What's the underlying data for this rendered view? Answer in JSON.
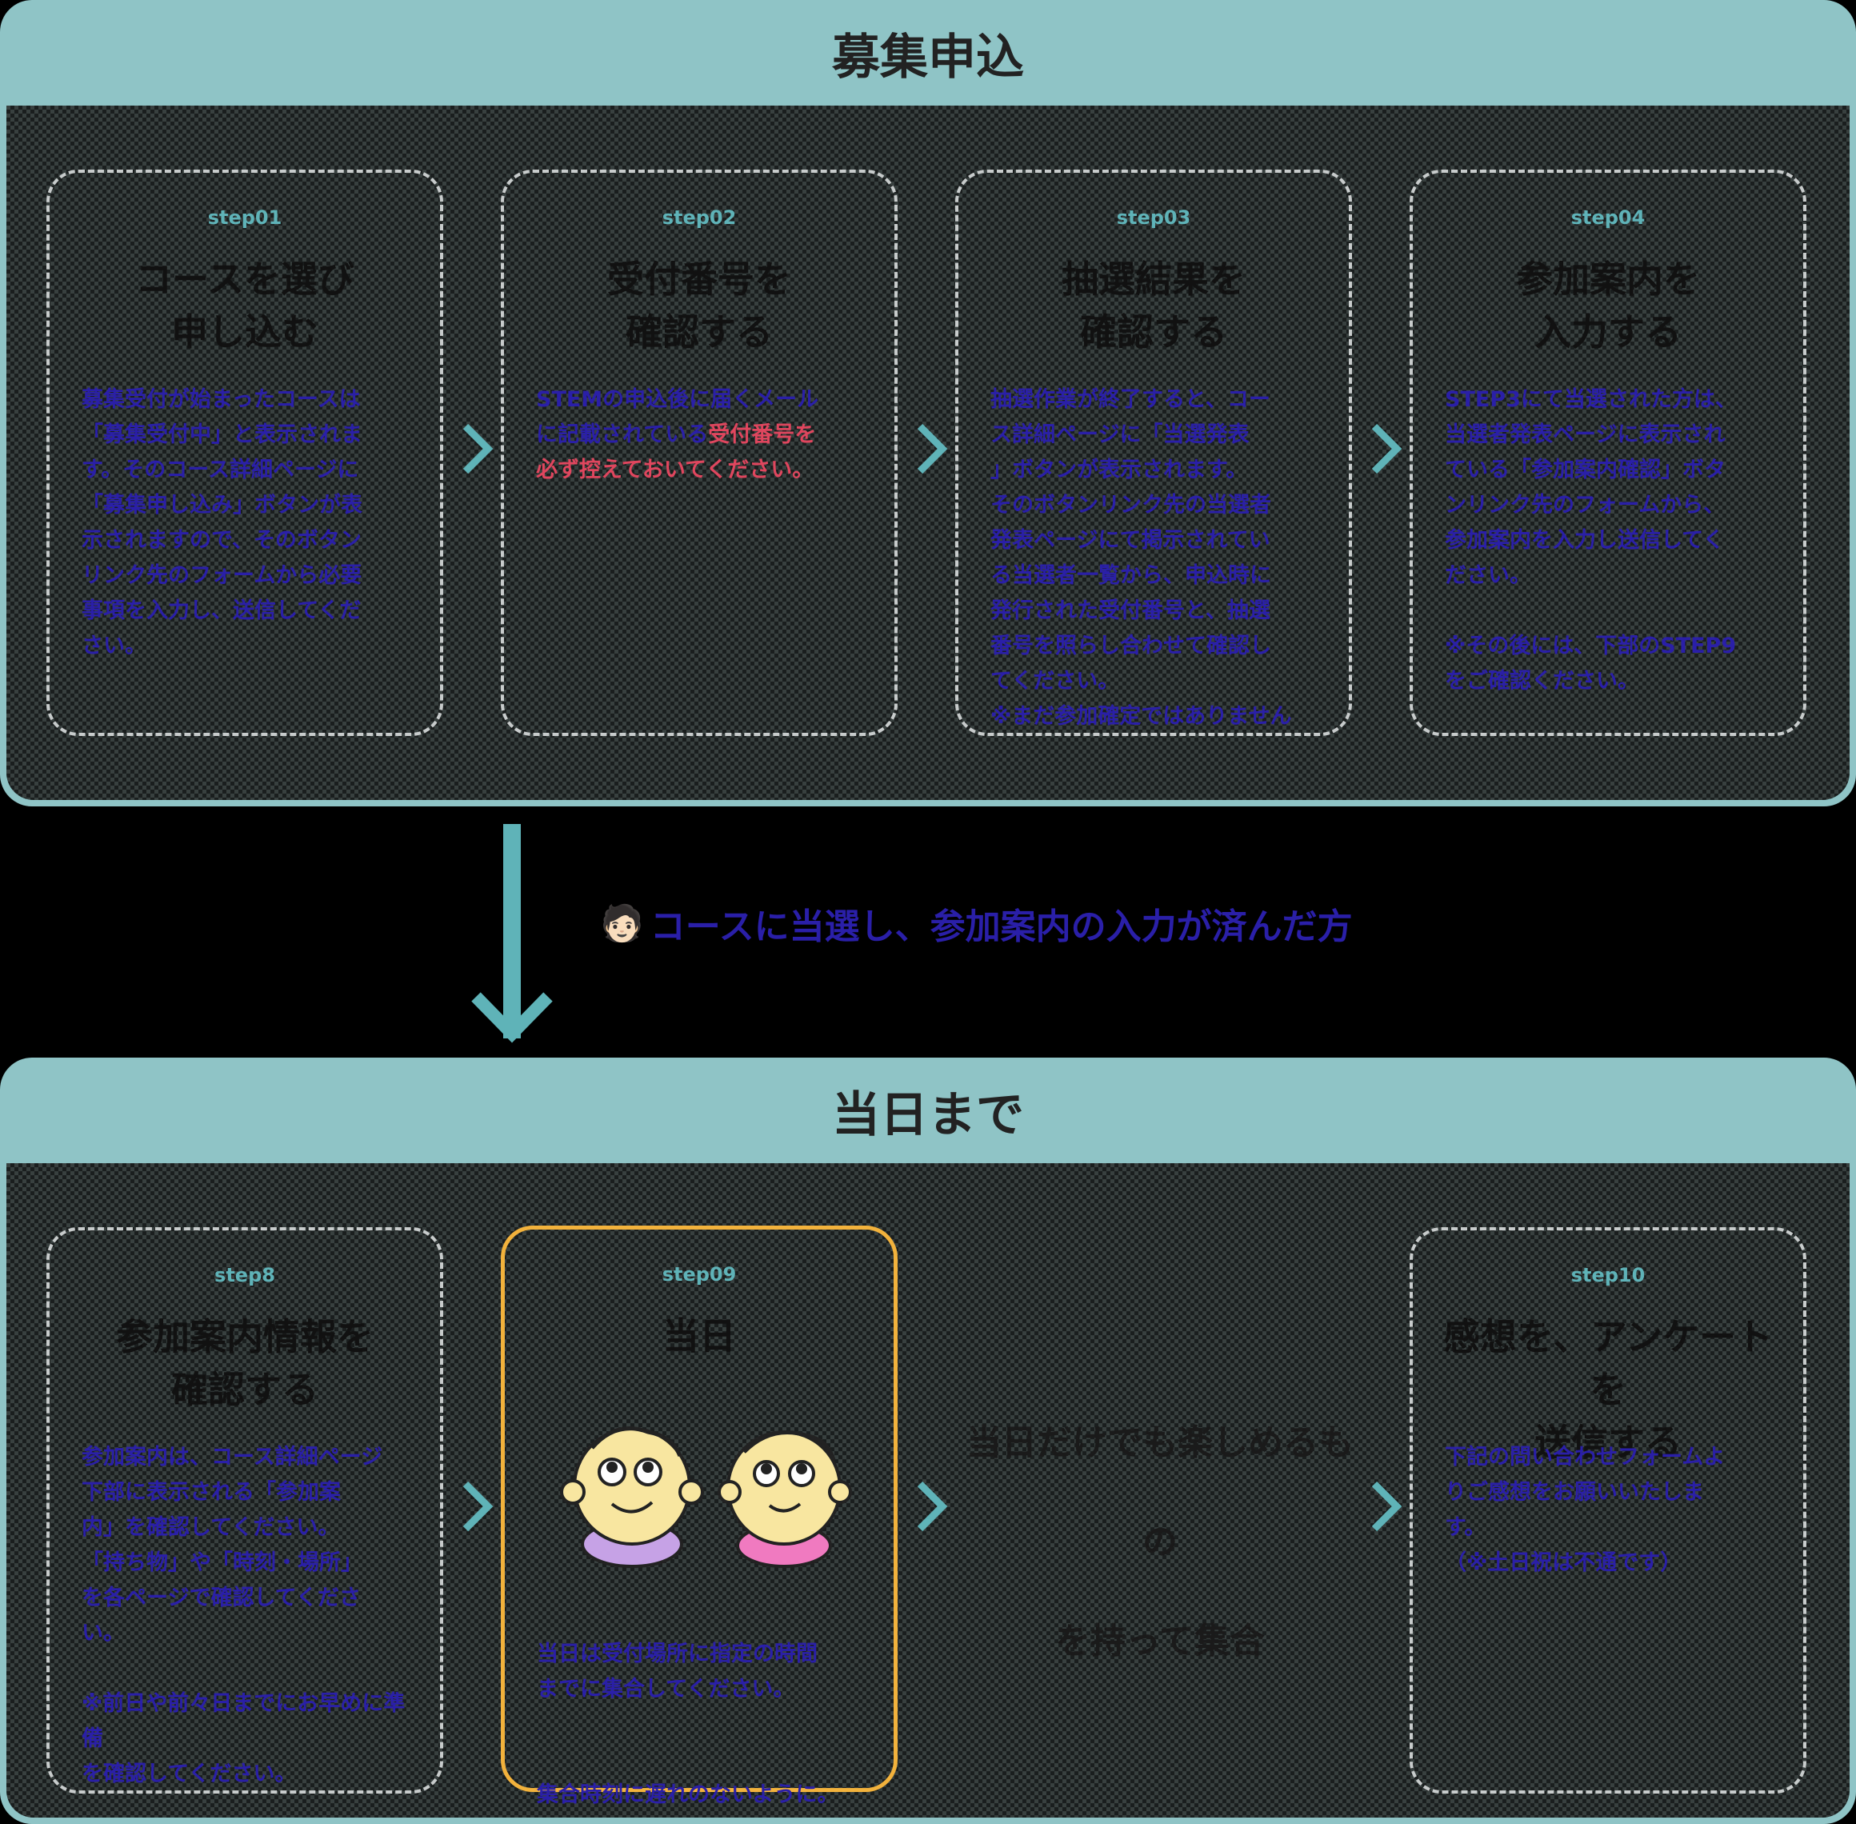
{
  "panel1": {
    "title": "募集申込",
    "cards": [
      {
        "step": "step01",
        "title_line1": "コースを選び",
        "title_line2": "申し込む",
        "text": "募集受付が始まったコースは\n「募集受付中」と表示されま\nす。そのコース詳細ページに\n「募集申し込み」ボタンが表\n示されますので、そのボタン\nリンク先のフォームから必要\n事項を入力し、送信してくだ\nさい。"
      },
      {
        "step": "step02",
        "title_line1": "受付番号を",
        "title_line2": "確認する",
        "text_a": "STEMの申込後に届くメール\nに記載されている",
        "text_red": "受付番号を\n必ず控えておいてください。"
      },
      {
        "step": "step03",
        "title_line1": "抽選結果を",
        "title_line2": "確認する",
        "text": "抽選作業が終了すると、コー\nス詳細ページに「当選発表\n」ボタンが表示されます。\nそのボタンリンク先の当選者\n発表ページにて掲示されてい\nる当選者一覧から、申込時に\n発行された受付番号と、抽選\n番号を照らし合わせて確認し\nてください。\n※まだ参加確定ではありません"
      },
      {
        "step": "step04",
        "title_line1": "参加案内を",
        "title_line2": "入力する",
        "text": "STEP3にて当選された方は、\n当選者発表ページに表示され\nている「参加案内確認」ボタ\nンリンク先のフォームから、\n参加案内を入力し送信してく\nださい。\n\n※その後には、下部のSTEP9\nをご確認ください。"
      }
    ]
  },
  "connector": {
    "avatar": "🧑🏻",
    "note": "コースに当選し、参加案内の入力が済んだ方"
  },
  "panel2": {
    "title": "当日まで",
    "cards": [
      {
        "step": "step8",
        "title_line1": "参加案内情報を",
        "title_line2": "確認する",
        "text": "参加案内は、コース詳細ページ\n下部に表示される「参加案\n内」を確認してください。\n「持ち物」や「時刻・場所」\nを各ページで確認してくださ\nい。\n\n※前日や前々日までにお早めに準備\nを確認してください。"
      },
      {
        "step": "step09",
        "title_line1": "当日",
        "text_a": "当日は受付場所に指定の時間\nまでに集合してください。",
        "text_b": "集合時刻に遅れのないように。"
      },
      {
        "step": "step10",
        "title_line1": "感想を、アンケートを",
        "title_line2": "送信する",
        "text": "下記の問い合わせフォームよ\nりご感想をお願いいたしま\nす。\n（※土日祝は不通です）"
      }
    ],
    "middle_line1": "当日だけでも楽しめるもの",
    "middle_line2": "を持って集合"
  },
  "colors": {
    "header": "#8fc4c6",
    "accent": "#5fb3b8",
    "highlight": "#f2b23c",
    "text_blue": "#2a1fa8",
    "text_red": "#e0465e"
  },
  "icons": [
    "chevron-right-icon",
    "arrow-down-icon",
    "person-emoji-icon",
    "kids-illustration"
  ]
}
